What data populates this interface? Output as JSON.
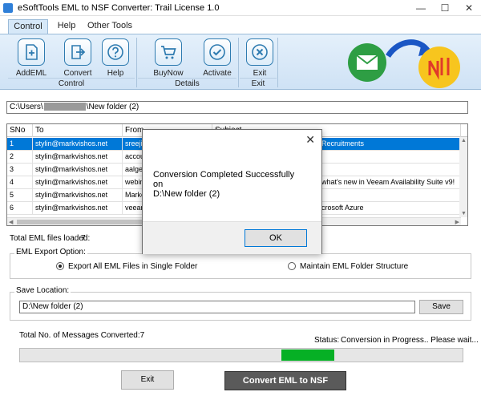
{
  "window": {
    "title": "eSoftTools EML to NSF Converter: Trail License 1.0",
    "controls": [
      "—",
      "☐",
      "✕"
    ]
  },
  "tabs": [
    {
      "label": "Control",
      "active": true
    },
    {
      "label": "Help",
      "active": false
    },
    {
      "label": "Other Tools",
      "active": false
    }
  ],
  "ribbon": {
    "buttons": {
      "add_eml": "AddEML",
      "convert": "Convert",
      "help": "Help",
      "buynow": "BuyNow",
      "activate": "Activate",
      "exit": "Exit"
    },
    "groups": {
      "control": "Control",
      "details": "Details",
      "exit": "Exit"
    }
  },
  "path": {
    "prefix": "C:\\Users\\",
    "suffix": "\\New folder (2)"
  },
  "table": {
    "headers": [
      "SNo",
      "To",
      "From",
      "Subject"
    ],
    "rows": [
      {
        "sno": "1",
        "to": "stylin@markvishos.net",
        "from": "sreejith",
        "subject": "Recruitments",
        "selected": true
      },
      {
        "sno": "2",
        "to": "stylin@markvishos.net",
        "from": "accoun",
        "subject": "",
        "selected": false
      },
      {
        "sno": "3",
        "to": "stylin@markvishos.net",
        "from": "aalgen",
        "subject": "",
        "selected": false
      },
      {
        "sno": "4",
        "to": "stylin@markvishos.net",
        "from": "webina",
        "subject": "what's new in Veeam Availability Suite v9!",
        "selected": false
      },
      {
        "sno": "5",
        "to": "stylin@markvishos.net",
        "from": "Market",
        "subject": "",
        "selected": false
      },
      {
        "sno": "6",
        "to": "stylin@markvishos.net",
        "from": "veeam",
        "subject": "crosoft Azure",
        "selected": false
      }
    ]
  },
  "summary": {
    "total_label": "Total EML files loaded:",
    "total_value": "7"
  },
  "export_option": {
    "legend": "EML Export Option:",
    "single_folder": "Export All EML Files in Single Folder",
    "maintain_structure": "Maintain EML Folder Structure",
    "selected": "single_folder"
  },
  "save_location": {
    "legend": "Save Location:",
    "value": "D:\\New folder (2)",
    "button": "Save"
  },
  "progress": {
    "converted_label": "Total No. of Messages Converted:7",
    "status_label": "Status:",
    "status_text": "Conversion in Progress.. Please wait..."
  },
  "footer": {
    "exit": "Exit",
    "convert": "Convert EML to NSF"
  },
  "dialog": {
    "close": "✕",
    "line1": "Conversion Completed Successfully",
    "line2": "on",
    "line3": "D:\\New folder (2)",
    "ok": "OK"
  },
  "colors": {
    "accent": "#0078d7",
    "progress_fill": "#06b025",
    "mail_logo": "#2e9e44",
    "notes_logo": "#f7c51e"
  }
}
